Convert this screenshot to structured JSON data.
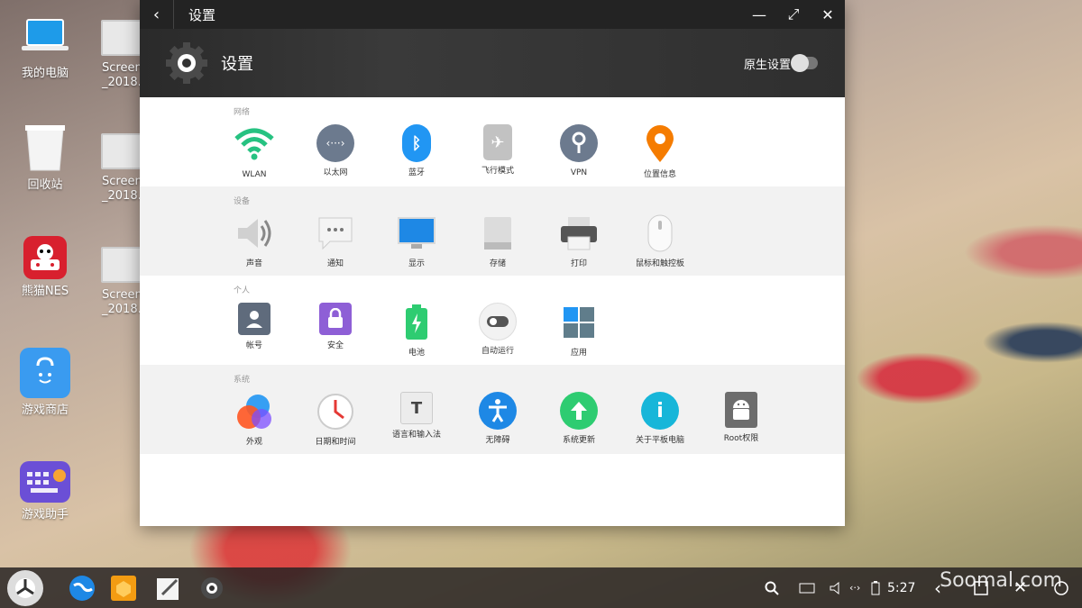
{
  "desktop": {
    "icons": [
      {
        "label": "我的电脑"
      },
      {
        "label": "回收站"
      },
      {
        "label": "熊猫NES"
      },
      {
        "label": "游戏商店"
      },
      {
        "label": "游戏助手"
      },
      {
        "label": "Screen\n_2018..."
      },
      {
        "label": "Screen\n_2018..."
      },
      {
        "label": "Screen\n_2018..."
      }
    ]
  },
  "window": {
    "title": "设置",
    "header_title": "设置",
    "native_settings_label": "原生设置",
    "controls": {
      "back": "‹",
      "minimize": "—",
      "maximize": "⤢",
      "close": "✕"
    }
  },
  "sections": [
    {
      "caption": "网络",
      "items": [
        {
          "label": "WLAN"
        },
        {
          "label": "以太网"
        },
        {
          "label": "蓝牙"
        },
        {
          "label": "飞行模式"
        },
        {
          "label": "VPN"
        },
        {
          "label": "位置信息"
        }
      ]
    },
    {
      "caption": "设备",
      "items": [
        {
          "label": "声音"
        },
        {
          "label": "通知"
        },
        {
          "label": "显示"
        },
        {
          "label": "存储"
        },
        {
          "label": "打印"
        },
        {
          "label": "鼠标和触控板"
        }
      ]
    },
    {
      "caption": "个人",
      "items": [
        {
          "label": "帐号"
        },
        {
          "label": "安全"
        },
        {
          "label": "电池"
        },
        {
          "label": "自动运行"
        },
        {
          "label": "应用"
        }
      ]
    },
    {
      "caption": "系统",
      "items": [
        {
          "label": "外观"
        },
        {
          "label": "日期和时间"
        },
        {
          "label": "语言和输入法"
        },
        {
          "label": "无障碍"
        },
        {
          "label": "系统更新"
        },
        {
          "label": "关于平板电脑"
        },
        {
          "label": "Root权限"
        }
      ]
    }
  ],
  "taskbar": {
    "time": "5:27",
    "watermark": "Soomal.com"
  }
}
